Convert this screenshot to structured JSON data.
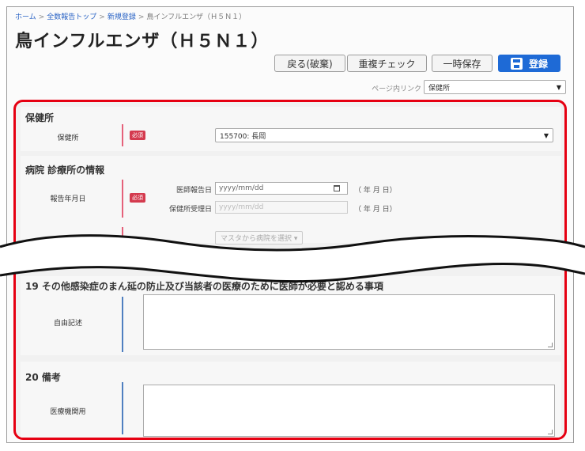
{
  "breadcrumb": {
    "home": "ホーム",
    "top": "全数報告トップ",
    "new": "新規登録",
    "current": "鳥インフルエンザ（Ｈ５Ｎ１）",
    "sep": ">"
  },
  "page_title": "鳥インフルエンザ（Ｈ５Ｎ１）",
  "toolbar": {
    "back_label": "戻る(破棄)",
    "dup_check_label": "重複チェック",
    "temp_save_label": "一時保存",
    "register_label": "登録"
  },
  "page_link": {
    "label": "ページ内リンク",
    "selected": "保健所"
  },
  "health_center": {
    "title": "保健所",
    "row_label": "保健所",
    "required_badge": "必須",
    "selected": "155700: 長岡"
  },
  "hospital": {
    "title": "病院 診療所の情報",
    "row_label": "報告年月日",
    "required_badge": "必須",
    "doctor_report_label": "医師報告日",
    "doctor_report_placeholder": "yyyy/mm/dd",
    "hc_received_label": "保健所受理日",
    "hc_received_placeholder": "yyyy/mm/dd",
    "ymd_hint": "（ 年 月 日）",
    "master_button": "マスタから病院を選択 ▾"
  },
  "section19": {
    "title": "19 その他感染症のまん延の防止及び当該者の医療のために医師が必要と認める事項",
    "row_label": "自由記述"
  },
  "section20": {
    "title": "20 備考",
    "row_label": "医療機関用"
  },
  "colors": {
    "accent_red": "#e60012",
    "primary_blue": "#1e6ad6",
    "required_red": "#d43a4e"
  }
}
